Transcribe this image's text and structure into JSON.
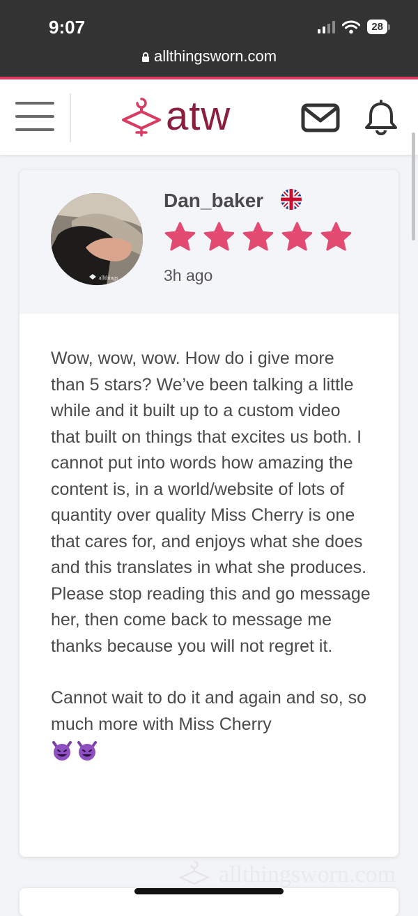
{
  "status_bar": {
    "time": "9:07",
    "battery": "28",
    "url": "allthingsworn.com"
  },
  "nav": {
    "logo_text": "atw",
    "icons": [
      "menu-icon",
      "mail-icon",
      "bell-icon"
    ]
  },
  "review": {
    "username": "Dan_baker",
    "flag": "uk-flag-icon",
    "rating": 5,
    "rating_max": 5,
    "time_ago": "3h ago",
    "paragraphs": [
      "Wow, wow, wow. How do i give more than 5 stars? We’ve been talking a little while and it built up to a custom video that built on things that excites us both. I cannot put into words how amazing the content is, in a world/website of lots of quantity over quality Miss Cherry is one that cares for, and enjoys what she does and this translates in what she produces. Please stop reading this and go message her, then come back to message me thanks because you will not regret it.",
      "Cannot wait to do it and again and so, so much more with Miss Cherry"
    ],
    "emojis": [
      "smiling-devil-emoji",
      "smiling-devil-emoji"
    ]
  },
  "watermark": "allthingsworn.com",
  "colors": {
    "star": "#e24a72",
    "accent_line": "#d83c62",
    "logo": "#8b1f3d",
    "hanger": "#d83c62"
  }
}
